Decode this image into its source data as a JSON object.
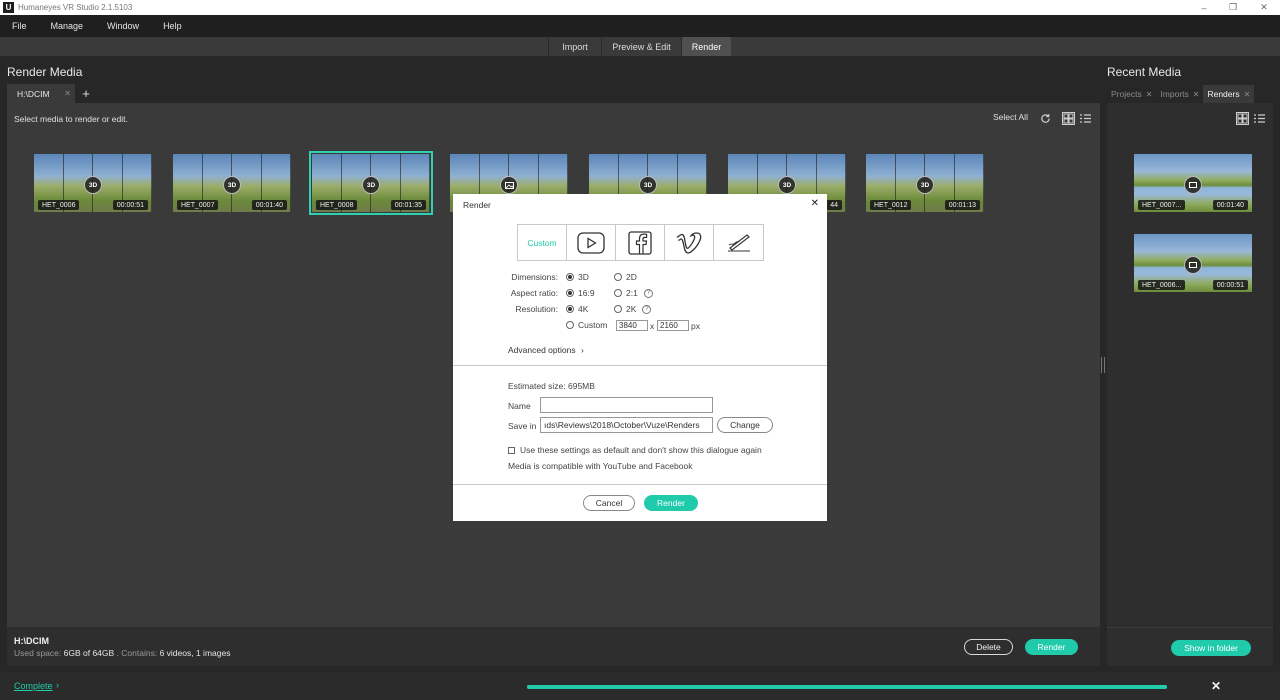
{
  "window": {
    "title": "Humaneyes VR Studio 2.1.5103",
    "logo_letter": "U"
  },
  "menu": {
    "items": [
      "File",
      "Manage",
      "Window",
      "Help"
    ]
  },
  "mode_tabs": [
    {
      "label": "Import"
    },
    {
      "label": "Preview & Edit"
    },
    {
      "label": "Render",
      "active": true
    }
  ],
  "render_media": {
    "title": "Render Media",
    "folder_tab": "H:\\DCIM",
    "hint": "Select media to render or edit.",
    "select_all": "Select All",
    "thumbnails": [
      {
        "name": "HET_0006",
        "duration": "00:00:51",
        "badge": "3D"
      },
      {
        "name": "HET_0007",
        "duration": "00:01:40",
        "badge": "3D"
      },
      {
        "name": "HET_0008",
        "duration": "00:01:35",
        "badge": "3D",
        "selected": true
      },
      {
        "name": "",
        "duration": "",
        "badge": "image"
      },
      {
        "name": "",
        "duration": "",
        "badge": "3D"
      },
      {
        "name": "",
        "duration": "44",
        "badge": "3D"
      },
      {
        "name": "HET_0012",
        "duration": "00:01:13",
        "badge": "3D"
      }
    ],
    "status": {
      "folder": "H:\\DCIM",
      "used_label": "Used space:",
      "used_value": "6GB of 64GB",
      "contains_label": ". Contains:",
      "contains_value": "6 videos, 1 images"
    },
    "delete_button": "Delete",
    "render_button": "Render"
  },
  "recent_media": {
    "title": "Recent Media",
    "tabs": [
      {
        "label": "Projects"
      },
      {
        "label": "Imports"
      },
      {
        "label": "Renders",
        "active": true
      }
    ],
    "thumbnails": [
      {
        "name": "HET_0007...",
        "duration": "00:01:40"
      },
      {
        "name": "HET_0006...",
        "duration": "00:00:51"
      }
    ],
    "show_in_folder": "Show in folder"
  },
  "bottom": {
    "complete_label": "Complete",
    "progress": 1.0
  },
  "dialog": {
    "title": "Render",
    "presets": [
      "Custom",
      "youtube-icon",
      "facebook-icon",
      "vimeo-icon",
      "signature-icon"
    ],
    "dimensions": {
      "label": "Dimensions:",
      "options": [
        "3D",
        "2D"
      ],
      "selected": "3D"
    },
    "aspect_ratio": {
      "label": "Aspect ratio:",
      "options": [
        "16:9",
        "2:1"
      ],
      "selected": "16:9"
    },
    "resolution": {
      "label": "Resolution:",
      "options": [
        "4K",
        "2K",
        "Custom"
      ],
      "selected": "4K"
    },
    "custom_width": "3840",
    "custom_x": "x",
    "custom_height": "2160",
    "custom_unit": "px",
    "advanced_options": "Advanced options",
    "estimated_size": "Estimated size: 695MB",
    "name_label": "Name",
    "name_value": "",
    "save_in_label": "Save in",
    "save_in_value": "ıds\\Reviews\\2018\\October\\Vuze\\Renders",
    "change_button": "Change",
    "default_checkbox": "Use these settings as default and don't show this dialogue again",
    "compat_note": "Media is compatible with YouTube and Facebook",
    "cancel_button": "Cancel",
    "render_button": "Render"
  },
  "colors": {
    "accent": "#1fcbab",
    "background": "#272727",
    "panel": "#3a3a3a"
  }
}
